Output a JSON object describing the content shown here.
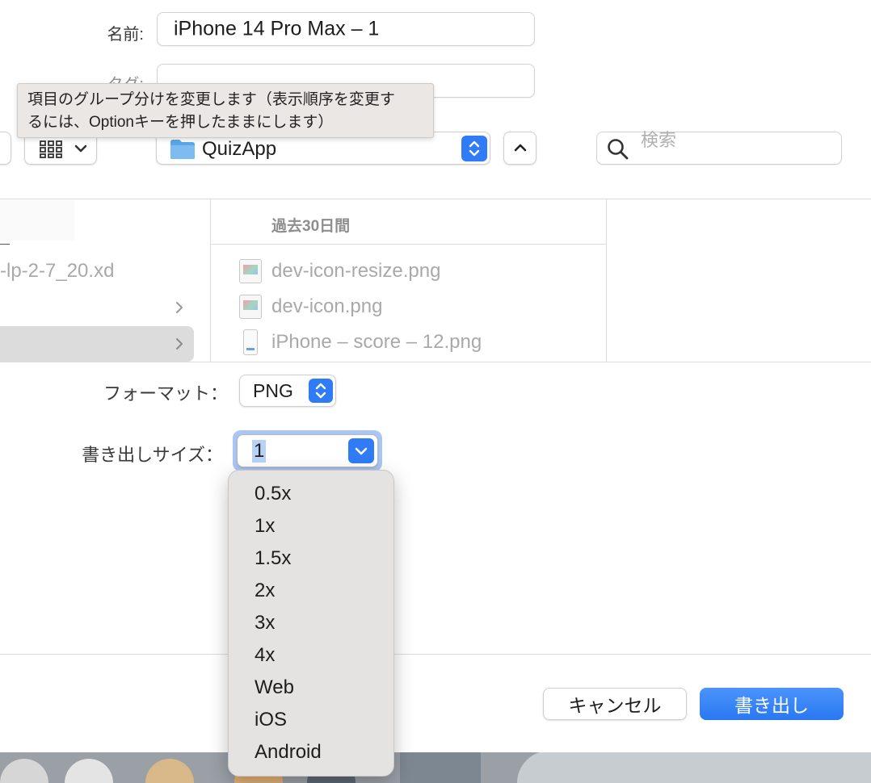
{
  "form": {
    "name_label": "名前:",
    "name_value": "iPhone 14 Pro Max – 1",
    "tag_label": "タグ:",
    "tag_value": ""
  },
  "tooltip": {
    "line1": "項目のグループ分けを変更します（表示順序を変更す",
    "line2": "るには、Optionキーを押したままにします）"
  },
  "toolbar": {
    "view_icon": "grid-icon",
    "folder_name": "QuizApp",
    "search_placeholder": "検索"
  },
  "browser": {
    "left_file": "-lp-2-7_20.xd",
    "column_header": "過去30日間",
    "files": [
      {
        "name": "dev-icon-resize.png",
        "icon": "image-file-icon"
      },
      {
        "name": "dev-icon.png",
        "icon": "image-file-icon"
      },
      {
        "name": "iPhone – score – 12.png",
        "icon": "phone-image-icon"
      }
    ]
  },
  "export": {
    "format_label": "フォーマット：",
    "format_value": "PNG",
    "size_label": "書き出しサイズ：",
    "size_value": "1",
    "size_options": [
      "0.5x",
      "1x",
      "1.5x",
      "2x",
      "3x",
      "4x",
      "Web",
      "iOS",
      "Android"
    ]
  },
  "buttons": {
    "cancel": "キャンセル",
    "export": "書き出し"
  },
  "colors": {
    "accent": "#2f7cf6",
    "focus_ring": "#9cbcf5"
  }
}
